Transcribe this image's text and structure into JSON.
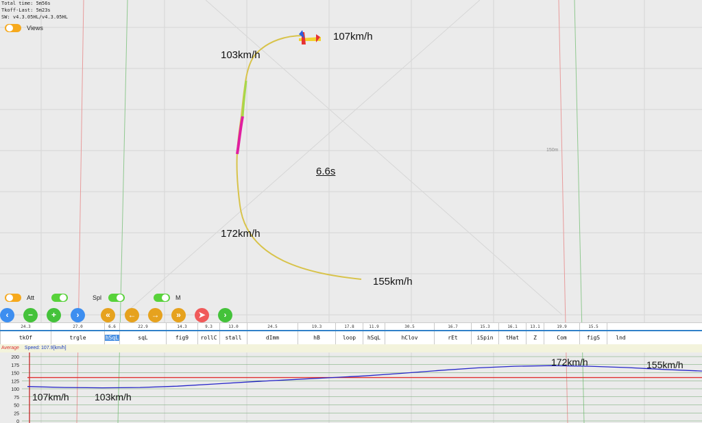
{
  "info": {
    "total_time": "Total time: 5m56s",
    "tkoff_last": "Tkoff-Last: 5m23s",
    "sw": "SW: v4.3.05HL/v4.3.05HL"
  },
  "views_label": "Views",
  "toggles": {
    "att": "Att",
    "spl": "Spl",
    "m": "M"
  },
  "controls": [
    "chevron-left-icon",
    "minus-icon",
    "plus-icon",
    "chevron-right-icon",
    "double-chevron-left-icon",
    "arrow-left-icon",
    "arrow-right-icon",
    "double-chevron-right-icon",
    "send-icon",
    "chevron-right-icon"
  ],
  "control_glyphs": [
    "‹",
    "−",
    "+",
    "›",
    "«",
    "←",
    "→",
    "»",
    "➤",
    "›"
  ],
  "flight_labels": {
    "top_right": "107km/h",
    "top_left": "103km/h",
    "middle": "172km/h",
    "bottom": "155km/h"
  },
  "duration": "6.6s",
  "distance_label": "150m",
  "sequence": [
    {
      "name": "tkOf",
      "score": "24.3"
    },
    {
      "name": "trgle",
      "score": "27.0"
    },
    {
      "name": "hSqL",
      "score": "6.6",
      "selected": true
    },
    {
      "name": "sqL",
      "score": "22.9"
    },
    {
      "name": "fig9",
      "score": "14.3"
    },
    {
      "name": "rollC",
      "score": "9.3"
    },
    {
      "name": "stall",
      "score": "13.0"
    },
    {
      "name": "dImm",
      "score": "24.5"
    },
    {
      "name": "hB",
      "score": "19.3"
    },
    {
      "name": "loop",
      "score": "17.8"
    },
    {
      "name": "hSqL",
      "score": "11.9"
    },
    {
      "name": "hClov",
      "score": "30.5"
    },
    {
      "name": "rEt",
      "score": "16.7"
    },
    {
      "name": "iSpin",
      "score": "15.3"
    },
    {
      "name": "tHat",
      "score": "16.1"
    },
    {
      "name": "Z",
      "score": "13.1"
    },
    {
      "name": "Com",
      "score": "19.9"
    },
    {
      "name": "figS",
      "score": "15.5"
    },
    {
      "name": "lnd",
      "score": ""
    }
  ],
  "graph": {
    "average_label": "Average",
    "speed_label": "Speed: 107.9[km/h]",
    "y_ticks": [
      "200",
      "175",
      "150",
      "125",
      "100",
      "75",
      "50",
      "25",
      "0"
    ],
    "average_value": 135,
    "speed_values": [
      107,
      104,
      103,
      104,
      108,
      115,
      122,
      128,
      134,
      140,
      148,
      157,
      165,
      170,
      172,
      170,
      166,
      160,
      155
    ],
    "labels": {
      "start": "107km/h",
      "min": "103km/h",
      "max": "172km/h",
      "end": "155km/h"
    },
    "colors": {
      "speed": "#2424c8",
      "average": "#e03030"
    }
  }
}
